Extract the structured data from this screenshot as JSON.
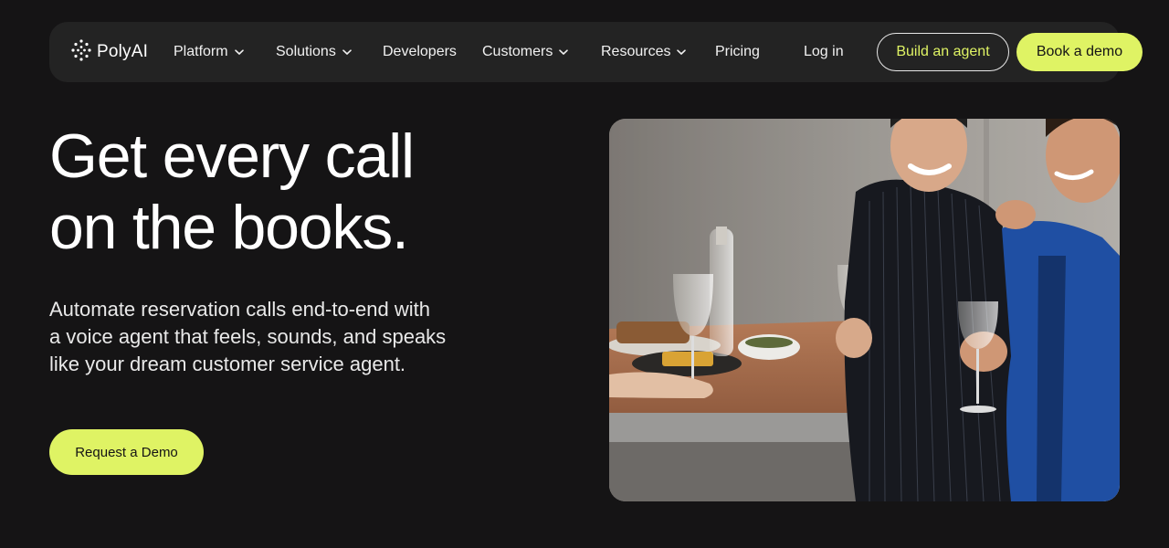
{
  "brand": {
    "name": "PolyAI",
    "accent_color": "#dff364",
    "background_color": "#151415"
  },
  "nav": {
    "items": [
      {
        "label": "Platform",
        "has_dropdown": true
      },
      {
        "label": "Solutions",
        "has_dropdown": true
      },
      {
        "label": "Developers",
        "has_dropdown": false
      },
      {
        "label": "Customers",
        "has_dropdown": true
      },
      {
        "label": "Resources",
        "has_dropdown": true
      },
      {
        "label": "Pricing",
        "has_dropdown": false
      }
    ],
    "login_label": "Log in",
    "build_agent_label": "Build an agent",
    "book_demo_label": "Book a demo"
  },
  "hero": {
    "title_lines": [
      "Get every call",
      "on the books."
    ],
    "subtitle_lines": [
      "Automate reservation calls end-to-end with",
      "a voice agent that feels, sounds, and speaks",
      "like your dream customer service agent."
    ],
    "cta_label": "Request a Demo"
  },
  "icons": {
    "logo": "polyai-dots-logo-icon",
    "dropdown": "chevron-down-icon"
  }
}
